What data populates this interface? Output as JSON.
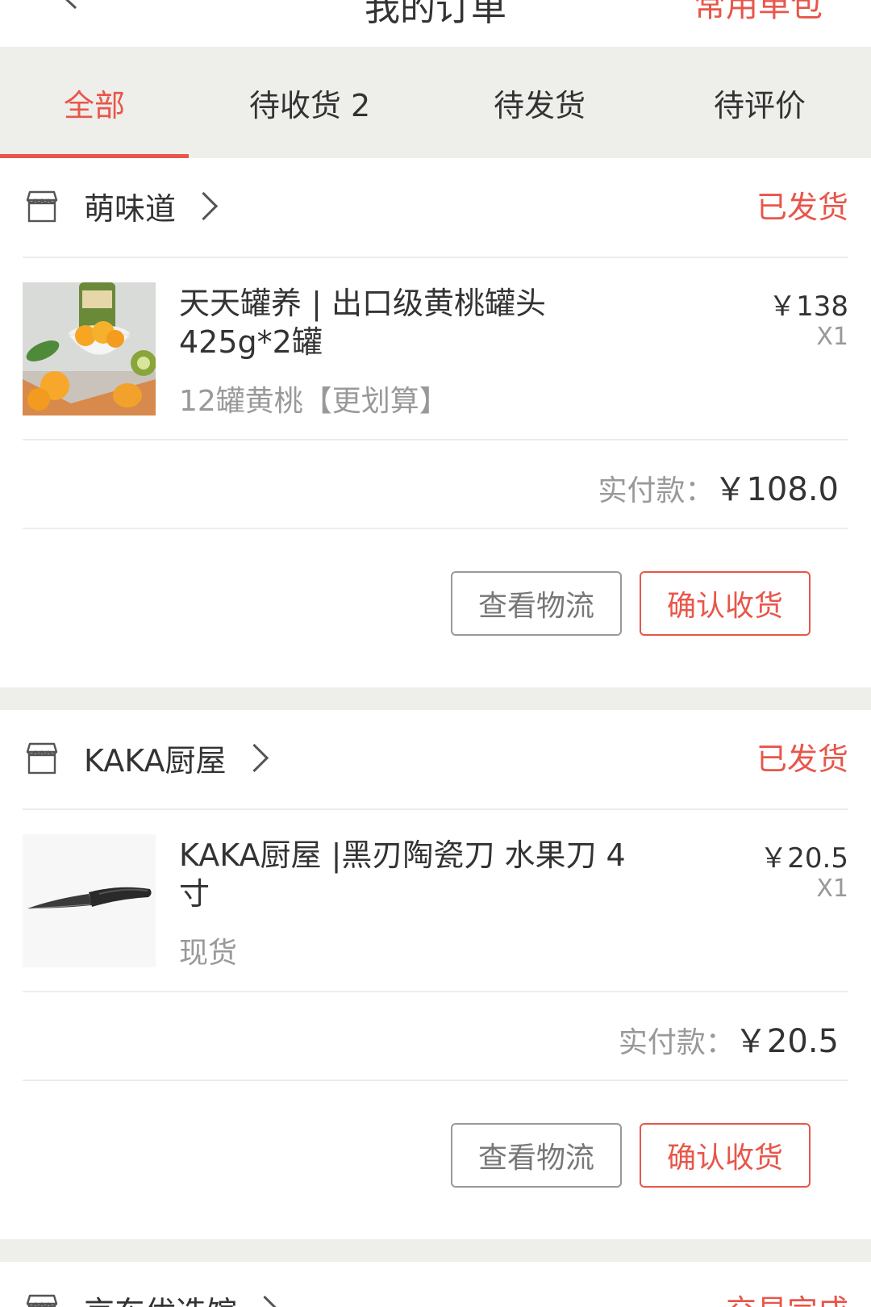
{
  "header": {
    "title": "我的订单",
    "right_action": "常用单包"
  },
  "tabs": [
    {
      "label": "全部",
      "active": true
    },
    {
      "label": "待收货 2",
      "active": false
    },
    {
      "label": "待发货",
      "active": false
    },
    {
      "label": "待评价",
      "active": false
    }
  ],
  "orders": [
    {
      "shop": "萌味道",
      "status": "已发货",
      "item": {
        "title": "天天罐养 | 出口级黄桃罐头 425g*2罐",
        "spec": "12罐黄桃【更划算】",
        "price": "￥138",
        "qty": "X1"
      },
      "pay_label": "实付款：",
      "pay_amount": "￥108.0",
      "buttons": {
        "logistics": "查看物流",
        "confirm": "确认收货"
      }
    },
    {
      "shop": "KAKA厨屋",
      "status": "已发货",
      "item": {
        "title": "KAKA厨屋 |黑刃陶瓷刀 水果刀 4寸",
        "spec": "现货",
        "price": "￥20.5",
        "qty": "X1"
      },
      "pay_label": "实付款：",
      "pay_amount": "￥20.5",
      "buttons": {
        "logistics": "查看物流",
        "confirm": "确认收货"
      }
    },
    {
      "shop": "京东优选馆",
      "status": "交易完成"
    }
  ],
  "colors": {
    "accent": "#e8564a",
    "tab_bg": "#eeeeea",
    "muted_text": "#999999"
  },
  "icons": {
    "back": "chevron-left-icon",
    "shop": "shop-icon",
    "chevron": "chevron-right-icon"
  }
}
